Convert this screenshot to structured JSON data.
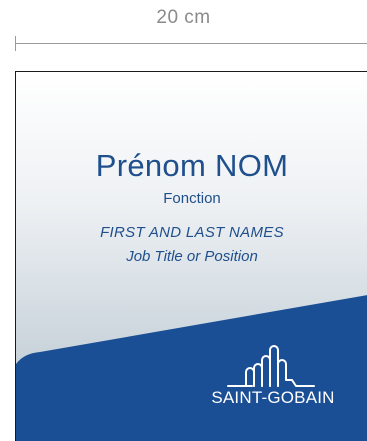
{
  "dimension": {
    "label": "20 cm"
  },
  "card": {
    "name": "Prénom NOM",
    "role": "Fonction",
    "name_en": "FIRST AND LAST NAMES",
    "role_en": "Job Title or Position"
  },
  "logo": {
    "text": "SAINT-GOBAIN",
    "icon": "saint-gobain-city-icon"
  },
  "colors": {
    "brand_blue": "#1a4f96",
    "text_blue": "#1f4f8c"
  }
}
